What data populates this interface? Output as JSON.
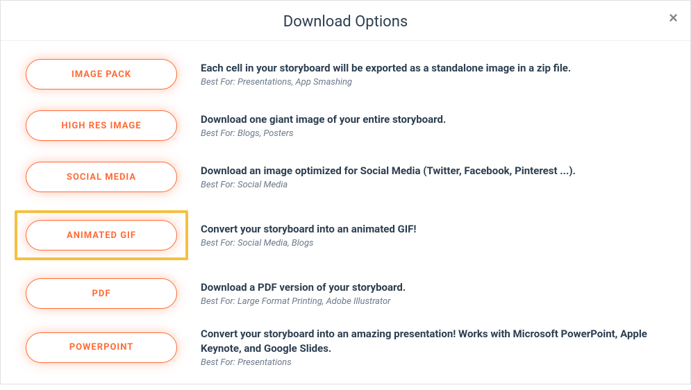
{
  "modal": {
    "title": "Download Options",
    "close_label": "×"
  },
  "options": [
    {
      "button_label": "IMAGE PACK",
      "description": "Each cell in your storyboard will be exported as a standalone image in a zip file.",
      "best_for": "Best For: Presentations, App Smashing",
      "highlighted": false
    },
    {
      "button_label": "HIGH RES IMAGE",
      "description": "Download one giant image of your entire storyboard.",
      "best_for": "Best For: Blogs, Posters",
      "highlighted": false
    },
    {
      "button_label": "SOCIAL MEDIA",
      "description": "Download an image optimized for Social Media (Twitter, Facebook, Pinterest ...).",
      "best_for": "Best For: Social Media",
      "highlighted": false
    },
    {
      "button_label": "ANIMATED GIF",
      "description": "Convert your storyboard into an animated GIF!",
      "best_for": "Best For: Social Media, Blogs",
      "highlighted": true
    },
    {
      "button_label": "PDF",
      "description": "Download a PDF version of your storyboard.",
      "best_for": "Best For: Large Format Printing, Adobe Illustrator",
      "highlighted": false
    },
    {
      "button_label": "POWERPOINT",
      "description": "Convert your storyboard into an amazing presentation! Works with Microsoft PowerPoint, Apple Keynote, and Google Slides.",
      "best_for": "Best For: Presentations",
      "highlighted": false
    }
  ]
}
